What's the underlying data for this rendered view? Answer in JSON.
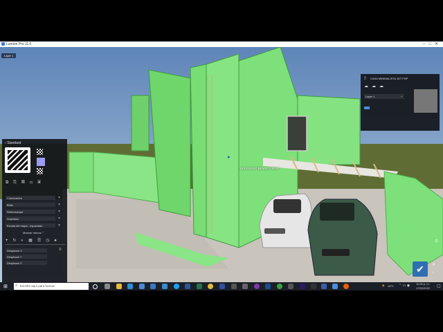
{
  "window": {
    "title": "Lumion Pro 11.5"
  },
  "viewport": {
    "layer_tab": "Layer 1",
    "object_label": "APLANADO BLANCO FINO"
  },
  "material_panel": {
    "title": "Standard",
    "properties": [
      {
        "label": "Colorización"
      },
      {
        "label": "Brillo"
      },
      {
        "label": "Reflectividad"
      },
      {
        "label": "Suavidad"
      },
      {
        "label": "Escala del mapa - espaciado"
      }
    ],
    "more_button": "Mostrar menos",
    "offsets": [
      "Desplazar X",
      "Desplazar Y",
      "Desplazar Z"
    ]
  },
  "project_panel": {
    "file_name": "CASA MINIMALISTA JDT FNP",
    "layer_select": "Layer 1"
  },
  "taskbar": {
    "search_placeholder": "Escribe aquí para buscar",
    "weather": "16°C",
    "time": "11:08 p. m.",
    "date": "17/02/2022"
  },
  "colors": {
    "sky_top": "#5e85b8",
    "sky_bottom": "#b5c9de",
    "grass": "#6b7a3a",
    "highlight_green": "#7ee07a",
    "ground": "#c8c3bb",
    "accent": "#4a8ed6"
  }
}
